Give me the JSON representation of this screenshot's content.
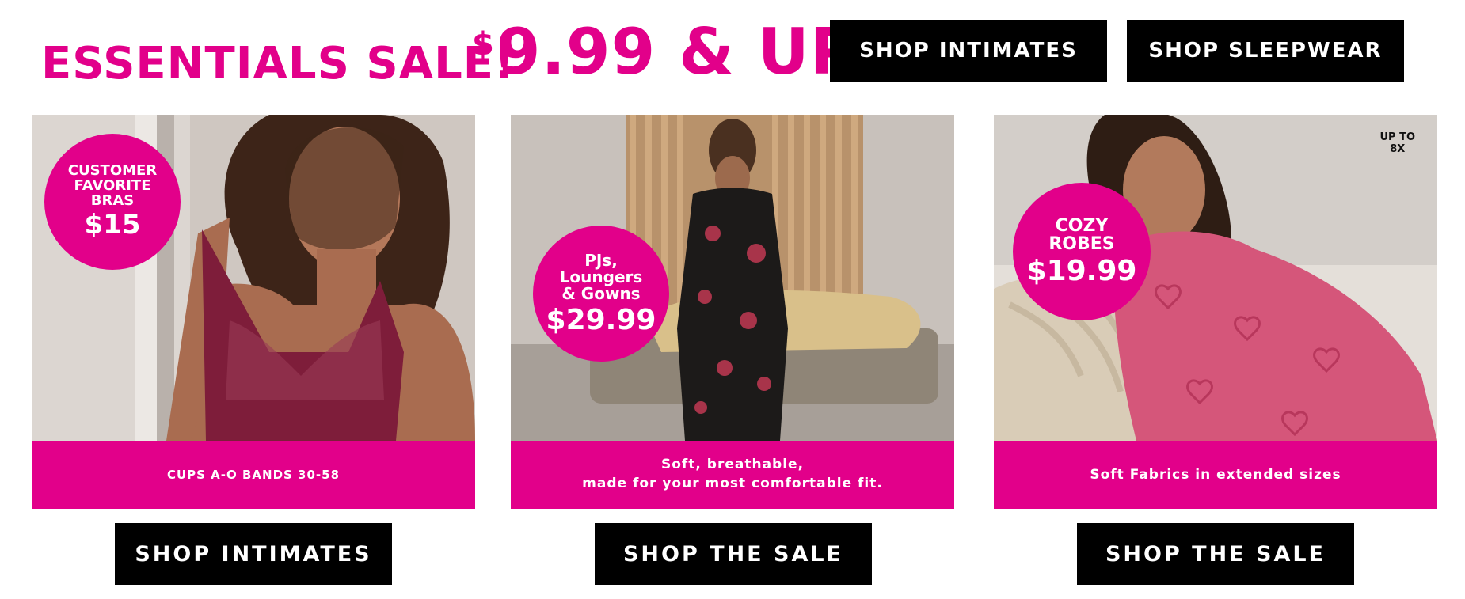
{
  "header": {
    "title": "ESSENTIALS SALE!",
    "price_symbol": "$",
    "price_text": "9.99 & UP",
    "buttons": [
      "SHOP INTIMATES",
      "SHOP SLEEPWEAR"
    ]
  },
  "cards": [
    {
      "badge": [
        "CUSTOMER",
        "FAVORITE",
        "BRAS"
      ],
      "badge_price": "$15",
      "band": "CUPS A-O BANDS 30-58",
      "button": "SHOP INTIMATES"
    },
    {
      "badge": [
        "PJs,",
        "Loungers",
        "& Gowns"
      ],
      "badge_price": "$29.99",
      "band_line1": "Soft, breathable,",
      "band_line2": "made for your most comfortable fit.",
      "button": "SHOP THE SALE"
    },
    {
      "badge": [
        "COZY",
        "ROBES"
      ],
      "badge_price": "$19.99",
      "corner_note": [
        "UP TO",
        "8X"
      ],
      "band": "Soft Fabrics in extended sizes",
      "button": "SHOP THE SALE"
    }
  ],
  "colors": {
    "accent": "#e2008a",
    "button": "#000000"
  }
}
